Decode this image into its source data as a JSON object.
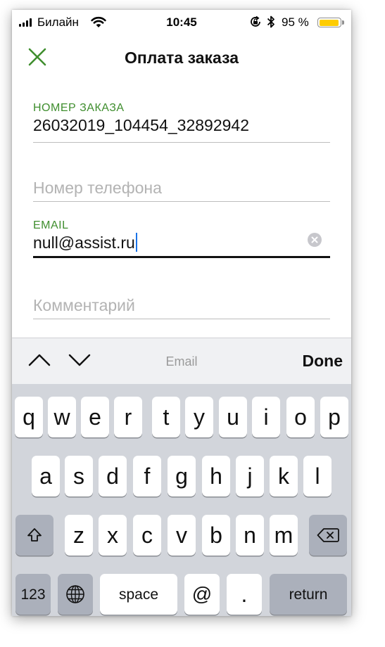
{
  "status_bar": {
    "carrier": "Билайн",
    "time": "10:45",
    "battery_percent": "95 %",
    "battery_level": 0.95,
    "icons": [
      "signal-icon",
      "wifi-icon",
      "rotation-lock-icon",
      "bluetooth-icon",
      "battery-icon"
    ]
  },
  "nav": {
    "title": "Оплата заказа",
    "close_icon": "close-icon"
  },
  "form": {
    "order_number": {
      "label": "НОМЕР ЗАКАЗА",
      "value": "26032019_104454_32892942"
    },
    "phone": {
      "placeholder": "Номер телефона",
      "value": ""
    },
    "email": {
      "label": "EMAIL",
      "value": "null@assist.ru"
    },
    "comment": {
      "placeholder": "Комментарий",
      "value": ""
    }
  },
  "accessory_bar": {
    "prev_icon": "chevron-up-icon",
    "next_icon": "chevron-down-icon",
    "field_name": "Email",
    "done_label": "Done"
  },
  "keyboard": {
    "row1": [
      "q",
      "w",
      "e",
      "r",
      "t",
      "y",
      "u",
      "i",
      "o",
      "p"
    ],
    "row2": [
      "a",
      "s",
      "d",
      "f",
      "g",
      "h",
      "j",
      "k",
      "l"
    ],
    "row3": [
      "z",
      "x",
      "c",
      "v",
      "b",
      "n",
      "m"
    ],
    "numbers_label": "123",
    "space_label": "space",
    "at_label": "@",
    "dot_label": ".",
    "return_label": "return",
    "shift_icon": "shift-icon",
    "delete_icon": "backspace-icon",
    "globe_icon": "globe-icon"
  },
  "colors": {
    "accent_green": "#3f8e2e",
    "caret_blue": "#1a73e8",
    "battery_yellow": "#ffcc00",
    "keyboard_bg": "#d2d5db"
  }
}
